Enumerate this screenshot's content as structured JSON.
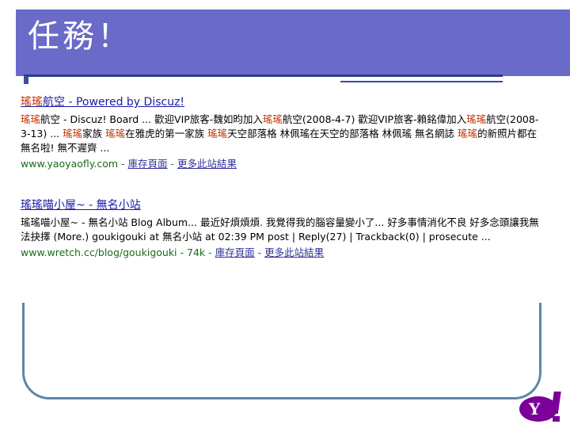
{
  "slide": {
    "title": "任務！"
  },
  "results": [
    {
      "title_hl": "瑤瑤",
      "title_rest": "航空 - Powered by Discuz!",
      "snippet_parts": [
        {
          "t": "瑤瑤",
          "hl": true
        },
        {
          "t": "航空 - Discuz! Board ... 歡迎VIP旅客-魏如昀加入",
          "hl": false
        },
        {
          "t": "瑤瑤",
          "hl": true
        },
        {
          "t": "航空(2008-4-7) 歡迎VIP旅客-賴銘偉加入",
          "hl": false
        },
        {
          "t": "瑤瑤",
          "hl": true
        },
        {
          "t": "航空(2008-3-13) ... ",
          "hl": false
        },
        {
          "t": "瑤瑤",
          "hl": true
        },
        {
          "t": "家族 ",
          "hl": false
        },
        {
          "t": "瑤瑤",
          "hl": true
        },
        {
          "t": "在雅虎的第一家族 ",
          "hl": false
        },
        {
          "t": "瑤瑤",
          "hl": true
        },
        {
          "t": "天空部落格 林佩瑤在天空的部落格 林佩瑤 無名網誌 ",
          "hl": false
        },
        {
          "t": "瑤瑤",
          "hl": true
        },
        {
          "t": "的新照片都在無名啦! 無不遲齊 ...",
          "hl": false
        }
      ],
      "url": "www.yaoyaofly.com",
      "cache_link": "庫存頁面",
      "more_link": "更多此站結果"
    },
    {
      "title_hl": "瑤瑤",
      "title_rest": "喵小屋~ - 無名小站",
      "snippet_parts": [
        {
          "t": "瑤瑤",
          "hl": false
        },
        {
          "t": "喵小屋~ - 無名小站 Blog Album... 最近好煩煩煩. 我覺得我的腦容量變小了... 好多事情消化不良 好多念頭讓我無法抉擇 (More.) goukigouki at 無名小站 at 02:39 PM post | Reply(27) | Trackback(0) | prosecute ...",
          "hl": false
        }
      ],
      "url": "www.wretch.cc/blog/goukigouki - 74k",
      "cache_link": "庫存頁面",
      "more_link": "更多此站結果"
    }
  ],
  "logo": {
    "text": "Y!",
    "color": "#7b0099"
  },
  "colors": {
    "header": "#6a6ac8",
    "accent_line": "#2e3b86",
    "frame": "#5e86a8",
    "highlight": "#c03000"
  }
}
